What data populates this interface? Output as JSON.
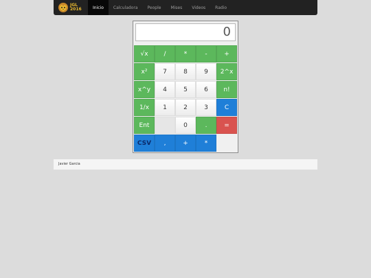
{
  "nav": {
    "brand": {
      "line1": "JGL",
      "line2": "2016"
    },
    "items": [
      {
        "label": "Inicio",
        "active": true
      },
      {
        "label": "Calculadora"
      },
      {
        "label": "People"
      },
      {
        "label": "Mises"
      },
      {
        "label": "Videos"
      },
      {
        "label": "Radio"
      }
    ]
  },
  "calculator": {
    "display": "0",
    "keys": {
      "sqrt": "√x",
      "divide": "/",
      "multiply": "*",
      "minus": "-",
      "plus": "+",
      "square": "x²",
      "seven": "7",
      "eight": "8",
      "nine": "9",
      "pow2": "2^x",
      "power": "x^y",
      "four": "4",
      "five": "5",
      "six": "6",
      "factorial": "n!",
      "reciprocal": "1/x",
      "one": "1",
      "two": "2",
      "three": "3",
      "clear": "C",
      "enter": "Ent",
      "zero": "0",
      "dot": ".",
      "equals": "=",
      "csv": "CSV",
      "comma": ",",
      "plus2": "+",
      "star": "*"
    }
  },
  "footer": {
    "author": "Javier Garcia"
  },
  "colors": {
    "green": "#5cb85c",
    "blue": "#1f7fd8",
    "red": "#d9534f",
    "navbar": "#222222"
  }
}
